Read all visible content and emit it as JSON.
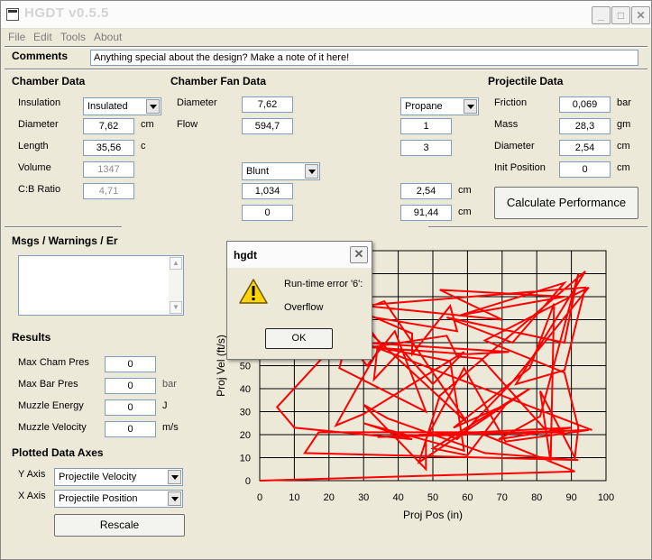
{
  "window": {
    "title": "HGDT v0.5.5"
  },
  "menu": [
    "File",
    "Edit",
    "Tools",
    "About"
  ],
  "comments": {
    "label": "Comments",
    "value": "Anything special about the design?  Make a note of it here!"
  },
  "chamber": {
    "heading": "Chamber Data",
    "insulation_label": "Insulation",
    "insulation_value": "Insulated",
    "diameter_label": "Diameter",
    "diameter_value": "7,62",
    "diameter_unit": "cm",
    "length_label": "Length",
    "length_value": "35,56",
    "length_unit": "c",
    "volume_label": "Volume",
    "volume_value": "1347",
    "cb_label": "C:B Ratio",
    "cb_value": "4,71"
  },
  "fan": {
    "heading": "Chamber Fan Data",
    "diameter_label": "Diameter",
    "diameter_value": "7,62",
    "flow_label": "Flow",
    "flow_value": "594,7",
    "shape_value": "Blunt",
    "v1": "1,034",
    "v2": "0"
  },
  "fuel": {
    "value": "Propane",
    "v1": "1",
    "v2": "3",
    "v3": "2,54",
    "v3_unit": "cm",
    "v4": "91,44",
    "v4_unit": "cm"
  },
  "projectile": {
    "heading": "Projectile Data",
    "friction_label": "Friction",
    "friction_value": "0,069",
    "friction_unit": "bar",
    "mass_label": "Mass",
    "mass_value": "28,3",
    "mass_unit": "gm",
    "diameter_label": "Diameter",
    "diameter_value": "2,54",
    "diameter_unit": "cm",
    "initpos_label": "Init Position",
    "initpos_value": "0",
    "initpos_unit": "cm"
  },
  "calc_button": "Calculate Performance",
  "msgs": {
    "heading": "Msgs / Warnings / Er"
  },
  "results": {
    "heading": "Results",
    "cham_label": "Max Cham Pres",
    "cham_value": "0",
    "bar_label": "Max Bar Pres",
    "bar_value": "0",
    "bar_unit": "bar",
    "energy_label": "Muzzle Energy",
    "energy_value": "0",
    "energy_unit": "J",
    "velocity_label": "Muzzle Velocity",
    "velocity_value": "0",
    "velocity_unit": "m/s"
  },
  "axes": {
    "heading": "Plotted Data Axes",
    "y_label": "Y Axis",
    "y_value": "Projectile Velocity",
    "x_label": "X Axis",
    "x_value": "Projectile Position",
    "rescale": "Rescale"
  },
  "dialog": {
    "title": "hgdt",
    "message": "Run-time error '6':",
    "detail": "Overflow",
    "ok": "OK"
  },
  "colors": {
    "line": "#ff0000",
    "grid": "#000000"
  },
  "chart_data": {
    "type": "line",
    "xlabel": "Proj Pos (in)",
    "ylabel": "Proj Vel (ft/s)",
    "xlim": [
      0,
      100
    ],
    "ylim": [
      0,
      100
    ],
    "xticks": [
      0,
      10,
      20,
      30,
      40,
      50,
      60,
      70,
      80,
      90,
      100
    ],
    "yticks": [
      0,
      10,
      20,
      30,
      40,
      50
    ],
    "series": [
      {
        "x": [
          0,
          91,
          63,
          17,
          13,
          92,
          65,
          37,
          30,
          48,
          48,
          59,
          71,
          95,
          54,
          57,
          73,
          95,
          65,
          88,
          92,
          91,
          81,
          84,
          85,
          78,
          56,
          71,
          60,
          50,
          78,
          46,
          52,
          94,
          74,
          88,
          94,
          28,
          9,
          36,
          60,
          27,
          23,
          48,
          39,
          31,
          24,
          5,
          10,
          44,
          30,
          59,
          55,
          34,
          33,
          41,
          50,
          59,
          30,
          22,
          35,
          29,
          57,
          55,
          44,
          44,
          24,
          70,
          52,
          88,
          58,
          88,
          73,
          54,
          88,
          92,
          81,
          69,
          90,
          34,
          60,
          46,
          88,
          82,
          64,
          57,
          54,
          32,
          60,
          72,
          30,
          96
        ],
        "y": [
          0,
          4,
          21,
          21,
          12,
          9,
          12,
          27,
          33,
          5,
          18,
          49,
          17,
          22,
          20,
          18,
          43,
          84,
          61,
          47,
          23,
          10,
          39,
          8,
          77,
          49,
          23,
          33,
          11,
          14,
          40,
          8,
          37,
          91,
          42,
          48,
          84,
          76,
          63,
          78,
          25,
          71,
          49,
          30,
          65,
          50,
          63,
          32,
          23,
          18,
          25,
          13,
          52,
          58,
          44,
          57,
          42,
          56,
          29,
          24,
          59,
          72,
          65,
          76,
          55,
          64,
          77,
          70,
          83,
          80,
          72,
          86,
          60,
          71,
          60,
          90,
          28,
          18,
          23,
          19,
          20,
          20,
          21,
          23,
          53,
          54,
          63,
          58,
          55,
          56,
          60,
          22
        ]
      }
    ]
  }
}
